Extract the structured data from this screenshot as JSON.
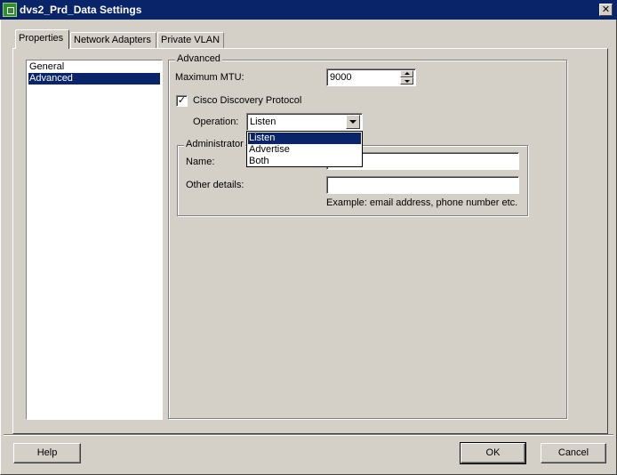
{
  "window": {
    "title": "dvs2_Prd_Data Settings",
    "close_glyph": "✕",
    "icon": "vsphere-switch-icon"
  },
  "tabs": [
    {
      "label": "Properties",
      "active": true
    },
    {
      "label": "Network Adapters",
      "active": false
    },
    {
      "label": "Private VLAN",
      "active": false
    }
  ],
  "sidebar": {
    "items": [
      {
        "label": "General",
        "selected": false
      },
      {
        "label": "Advanced",
        "selected": true
      }
    ]
  },
  "advanced": {
    "group_label": "Advanced",
    "mtu_label": "Maximum MTU:",
    "mtu_value": "9000",
    "cdp_label": "Cisco Discovery Protocol",
    "cdp_checked": true,
    "check_glyph": "✓",
    "operation_label": "Operation:",
    "operation_value": "Listen",
    "operation_options": [
      "Listen",
      "Advertise",
      "Both"
    ],
    "admin_group_label": "Administrator",
    "name_label": "Name:",
    "name_value": "",
    "other_label": "Other details:",
    "other_value": "",
    "hint": "Example: email address, phone number etc."
  },
  "buttons": {
    "help": "Help",
    "ok": "OK",
    "cancel": "Cancel"
  },
  "colors": {
    "titlebar": "#0a246a",
    "selection": "#0a246a",
    "face": "#d4d0c8"
  }
}
